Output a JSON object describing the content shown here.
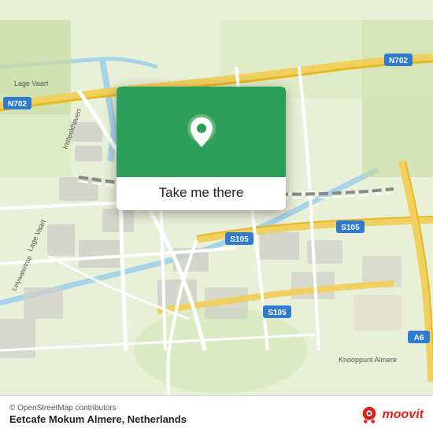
{
  "map": {
    "bg_color": "#e8f0d8",
    "center_lat": 52.37,
    "center_lng": 5.22
  },
  "popup": {
    "label": "Take me there",
    "icon": "location-pin"
  },
  "bottom_bar": {
    "attribution": "© OpenStreetMap contributors",
    "place_name": "Eetcafe Mokum Almere, Netherlands",
    "logo_text": "moovit"
  },
  "roads": {
    "n702_label": "N702",
    "n702_label2": "N702",
    "s105_label": "S105",
    "s105_label2": "S105",
    "s105_label3": "S105",
    "a6_label": "A6",
    "knooppunt_label": "Knooppunt Almere",
    "lage_vaart_label": "Lage Vaart",
    "insteekhaven_label": "Insteekhaven",
    "lelywatertrap_label": "Lelywatertrap"
  }
}
